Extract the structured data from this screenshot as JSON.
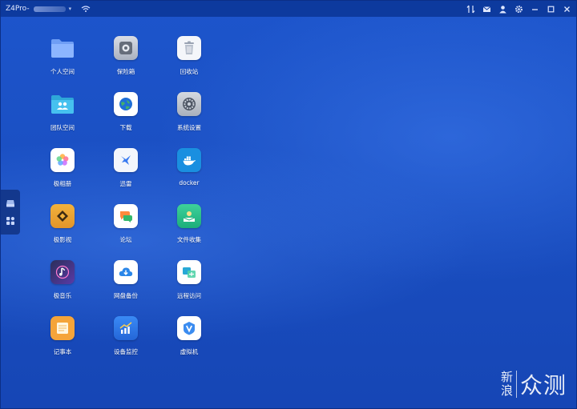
{
  "titlebar": {
    "device_name": "Z4Pro-",
    "device_suffix_hidden": "",
    "caret": "▾",
    "icons": [
      "wifi-icon",
      "transfer-icon",
      "mail-icon",
      "user-icon",
      "settings-icon",
      "minimize-icon",
      "maximize-icon",
      "close-icon"
    ]
  },
  "side_dock": {
    "items": [
      "storage-icon",
      "apps-grid-icon"
    ]
  },
  "apps": [
    {
      "label": "个人空间",
      "icon": "personal-folder-icon"
    },
    {
      "label": "保险箱",
      "icon": "safe-icon"
    },
    {
      "label": "回收站",
      "icon": "recycle-bin-icon"
    },
    {
      "label": "团队空间",
      "icon": "team-folder-icon"
    },
    {
      "label": "下载",
      "icon": "download-globe-icon"
    },
    {
      "label": "系统设置",
      "icon": "system-settings-icon"
    },
    {
      "label": "极相册",
      "icon": "photos-icon"
    },
    {
      "label": "迅雷",
      "icon": "thunder-icon"
    },
    {
      "label": "docker",
      "icon": "docker-icon"
    },
    {
      "label": "极影视",
      "icon": "video-icon"
    },
    {
      "label": "论坛",
      "icon": "forum-icon"
    },
    {
      "label": "文件收集",
      "icon": "file-collect-icon"
    },
    {
      "label": "极音乐",
      "icon": "music-icon"
    },
    {
      "label": "网盘备份",
      "icon": "cloud-backup-icon"
    },
    {
      "label": "远程访问",
      "icon": "remote-access-icon"
    },
    {
      "label": "记事本",
      "icon": "notepad-icon"
    },
    {
      "label": "设备监控",
      "icon": "device-monitor-icon"
    },
    {
      "label": "虚拟机",
      "icon": "virtual-machine-icon"
    }
  ],
  "watermark": {
    "line1": "新",
    "line2": "浪",
    "big": "众测"
  },
  "colors": {
    "desktop": "#1b4fc4",
    "titlebar": "#0d3a9e"
  }
}
